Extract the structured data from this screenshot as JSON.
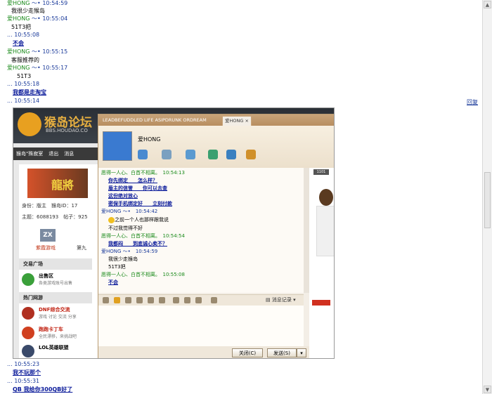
{
  "chat_log": {
    "lines": [
      {
        "name": "爱HONG",
        "tail": "～•",
        "time": "10:54:59"
      },
      {
        "msg": "我很少走猴岛"
      },
      {
        "name": "爱HONG",
        "tail": "～•",
        "time": "10:55:04"
      },
      {
        "msg": "51T3把"
      },
      {
        "prefix": "...",
        "time": "10:55:08"
      },
      {
        "link": "不会"
      },
      {
        "name": "爱HONG",
        "tail": "～•",
        "time": "10:55:15"
      },
      {
        "msg": "客服推荐的"
      },
      {
        "name": "爱HONG",
        "tail": "～•",
        "time": "10:55:17"
      },
      {
        "msg": "51T3"
      },
      {
        "prefix": "...",
        "time": "10:55:18"
      },
      {
        "link": "我都是走淘宝"
      },
      {
        "prefix": "...",
        "time": "10:55:14"
      }
    ],
    "bottom_lines": [
      {
        "prefix": "...",
        "time": "10:55:23"
      },
      {
        "link": "我不玩那个"
      },
      {
        "prefix": "...",
        "time": "10:55:31"
      },
      {
        "link": "QB 我给你300QB好了"
      }
    ],
    "reply_label": "回复"
  },
  "forum": {
    "title": "猴岛论坛",
    "url": "BBS.HOUDAO.CO",
    "nav": [
      "猴岛\"殊寂室",
      "退出",
      "消息"
    ],
    "banner_text": "龍將",
    "identity": "身份：版主",
    "account_id": "猴岛ID：17",
    "topics": "主题：6088193",
    "posts": "帖子：925",
    "zx_label": "紫霞游戏",
    "ninth": "第九",
    "sections": {
      "trade": "交易广场",
      "hot": "热门网游"
    },
    "boards": [
      {
        "title": "出售区",
        "sub": "各类游戏账号出售"
      },
      {
        "title": "DNF综合交流",
        "sub": "游戏 讨论 交流 分享"
      },
      {
        "title": "跑跑卡丁车",
        "sub": "全民漂移，来挑战吧"
      },
      {
        "title": "LOL英雄联盟",
        "sub": ""
      }
    ]
  },
  "qq": {
    "tab1": "LEADBEFUDDLED LIFE ASIPDRUNK ORDREAM",
    "tab2": "爱HONG",
    "contact_name": "爱HONG",
    "messages": [
      {
        "name": "愿得一人心、白首不相离。",
        "time": "10:54:13"
      },
      {
        "link": "你先绑定　　怎么样？"
      },
      {
        "link": "盾主的信誉　　你可以去查"
      },
      {
        "link": "这份绝对放心"
      },
      {
        "link": "密保手机绑定好　　立刻付款"
      },
      {
        "name2": "爱HONG",
        "tail": "～•",
        "time": "10:54:42"
      },
      {
        "msg": "之前一个人也那样跟我说",
        "emoji": true
      },
      {
        "msg": "不过我觉得不好"
      },
      {
        "name": "愿得一人心、白首不相离。",
        "time": "10:54:54"
      },
      {
        "link": "我都闷　　到底诚心卖不？"
      },
      {
        "name2": "爱HONG",
        "tail": "～•",
        "time": "10:54:59"
      },
      {
        "msg": "我很少走猴岛"
      },
      {
        "msg": "51T3把"
      },
      {
        "name": "愿得一人心、白首不相离。",
        "time": "10:55:08"
      },
      {
        "link": "不会"
      }
    ],
    "record_label": "消息记录",
    "close_label": "关闭(C)",
    "send_label": "发送(S)",
    "side_badge": "1101"
  }
}
